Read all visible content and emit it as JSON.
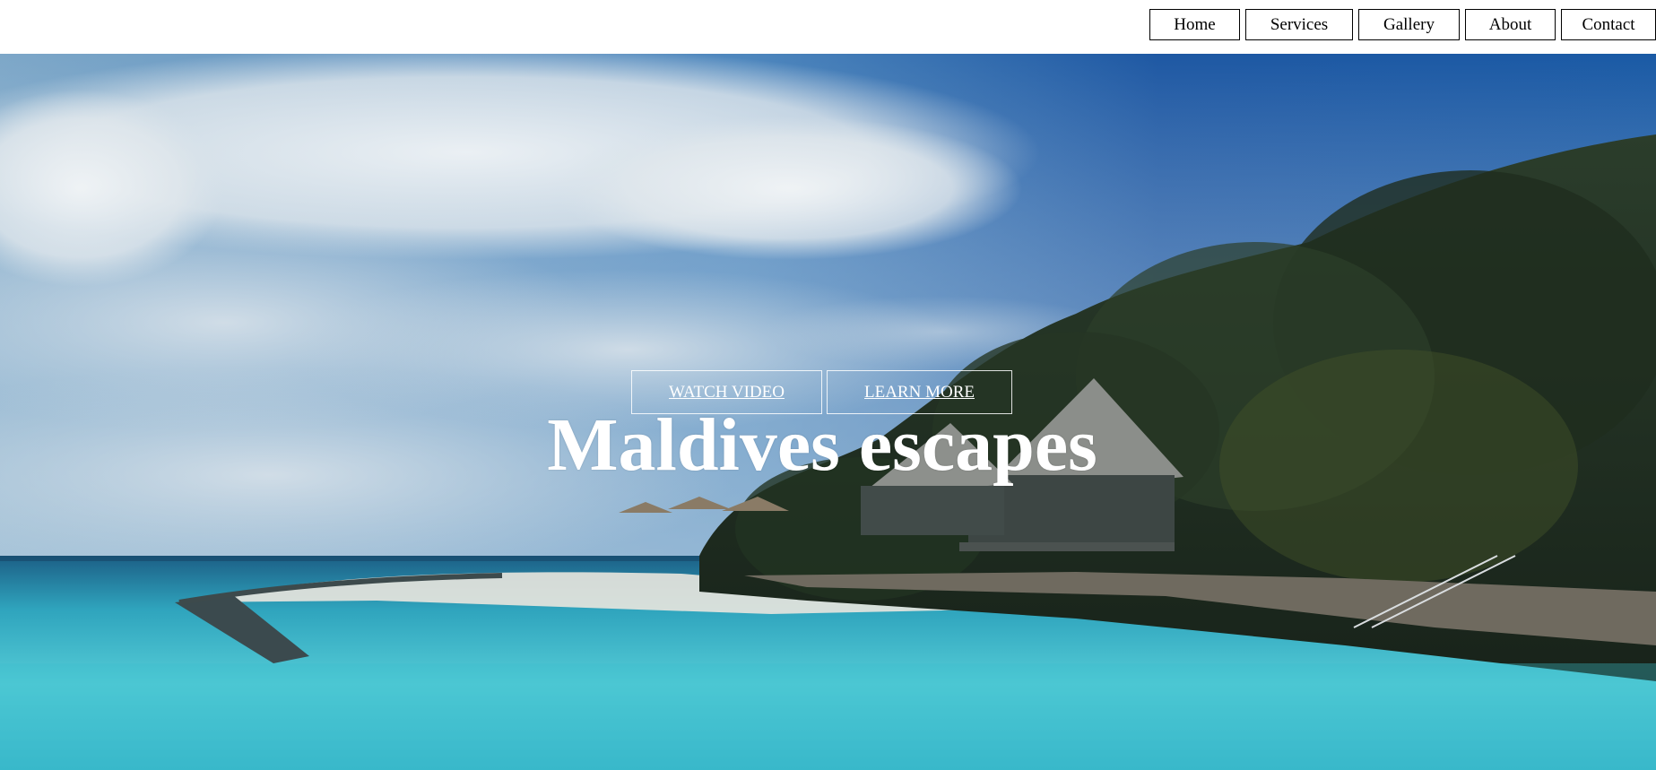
{
  "nav": {
    "items": [
      {
        "label": "Home"
      },
      {
        "label": "Services"
      },
      {
        "label": "Gallery"
      },
      {
        "label": "About"
      },
      {
        "label": "Contact"
      }
    ]
  },
  "hero": {
    "buttons": {
      "watch_video": "WATCH VIDEO",
      "learn_more": "LEARN MORE"
    },
    "headline": "Maldives escapes"
  },
  "colors": {
    "sky_blue": "#1f5ea8",
    "cloud_white": "#e3e9ee",
    "lagoon": "#3fc2d1",
    "foliage": "#22301f",
    "sand": "#eeeae2",
    "text": "#ffffff"
  }
}
